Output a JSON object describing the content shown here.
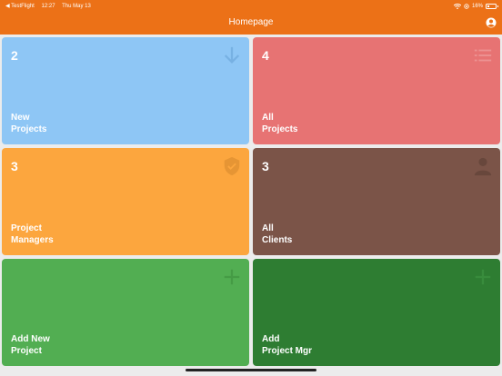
{
  "status": {
    "back_app": "◀ TestFlight",
    "time": "12:27",
    "date": "Thu May 13",
    "battery": "16%"
  },
  "header": {
    "title": "Homepage",
    "account_icon": "account-circle-icon"
  },
  "tiles": [
    {
      "count": "2",
      "label": "New\nProjects",
      "color": "#8ec6f5",
      "icon": "download-arrow-icon"
    },
    {
      "count": "4",
      "label": "All\nProjects",
      "color": "#e77373",
      "icon": "list-icon"
    },
    {
      "count": "3",
      "label": "Project\nManagers",
      "color": "#fca63e",
      "icon": "shield-check-icon"
    },
    {
      "count": "3",
      "label": "All\nClients",
      "color": "#7b5448",
      "icon": "person-icon"
    },
    {
      "count": "",
      "label": "Add New\nProject",
      "color": "#52ae52",
      "icon": "plus-icon"
    },
    {
      "count": "",
      "label": "Add\nProject Mgr",
      "color": "#2e7d32",
      "icon": "plus-icon"
    }
  ]
}
